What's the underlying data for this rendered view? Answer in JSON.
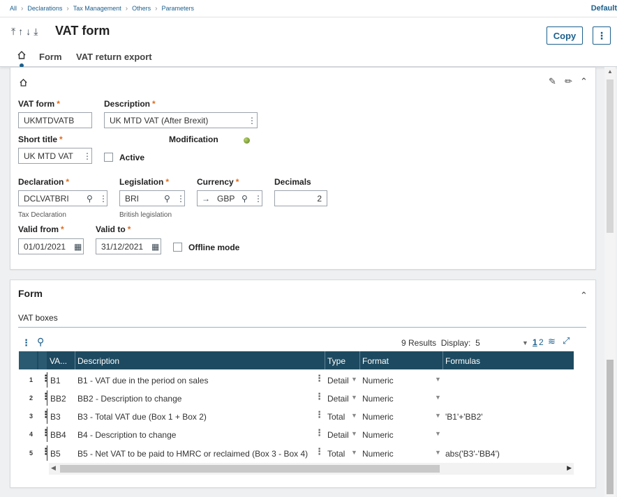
{
  "breadcrumb": [
    "All",
    "Declarations",
    "Tax Management",
    "Others",
    "Parameters"
  ],
  "top_right": "Default",
  "header": {
    "title": "VAT form",
    "copy_label": "Copy",
    "tabs": [
      "Form",
      "VAT return export"
    ]
  },
  "fields": {
    "vat_form": {
      "label": "VAT form",
      "value": "UKMTDVATB"
    },
    "description": {
      "label": "Description",
      "value": "UK MTD VAT (After Brexit)"
    },
    "short_title": {
      "label": "Short title",
      "value": "UK MTD VAT"
    },
    "modification": {
      "label": "Modification"
    },
    "active": {
      "label": "Active"
    },
    "declaration": {
      "label": "Declaration",
      "value": "DCLVATBRI",
      "hint": "Tax Declaration"
    },
    "legislation": {
      "label": "Legislation",
      "value": "BRI",
      "hint": "British legislation"
    },
    "currency": {
      "label": "Currency",
      "value": "GBP"
    },
    "decimals": {
      "label": "Decimals",
      "value": "2"
    },
    "valid_from": {
      "label": "Valid from",
      "value": "01/01/2021"
    },
    "valid_to": {
      "label": "Valid to",
      "value": "31/12/2021"
    },
    "offline": {
      "label": "Offline mode"
    }
  },
  "form_section": {
    "title": "Form",
    "subtitle": "VAT boxes",
    "results": "9 Results",
    "display_label": "Display:",
    "display_value": "5",
    "pages": [
      "1",
      "2"
    ],
    "columns": [
      "VA...",
      "Description",
      "Type",
      "Format",
      "Formulas"
    ],
    "rows": [
      {
        "n": "1",
        "code": "B1",
        "desc": "B1 - VAT due in the period on sales",
        "type": "Detail",
        "format": "Numeric",
        "formula": ""
      },
      {
        "n": "2",
        "code": "BB2",
        "desc": "BB2 - Description to change",
        "type": "Detail",
        "format": "Numeric",
        "formula": ""
      },
      {
        "n": "3",
        "code": "B3",
        "desc": "B3 - Total VAT due (Box 1 + Box 2)",
        "type": "Total",
        "format": "Numeric",
        "formula": "'B1'+'BB2'"
      },
      {
        "n": "4",
        "code": "BB4",
        "desc": "B4 - Description to change",
        "type": "Detail",
        "format": "Numeric",
        "formula": ""
      },
      {
        "n": "5",
        "code": "B5",
        "desc": "B5 - Net VAT to be paid to HMRC or reclaimed (Box 3 - Box 4)",
        "type": "Total",
        "format": "Numeric",
        "formula": "abs('B3'-'BB4')"
      }
    ]
  }
}
